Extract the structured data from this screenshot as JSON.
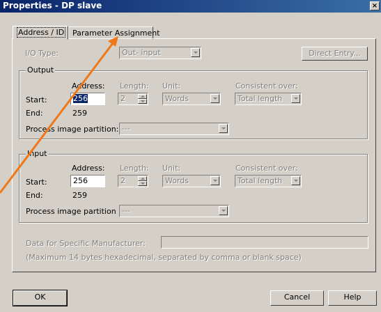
{
  "window": {
    "title": "Properties - DP slave",
    "close": "×"
  },
  "tabs": [
    {
      "label": "Address / ID"
    },
    {
      "label": "Parameter Assignment"
    }
  ],
  "io_type": {
    "label": "I/O Type:",
    "value": "Out- input"
  },
  "direct_entry": "Direct Entry...",
  "output": {
    "title": "Output",
    "headers": {
      "address": "Address:",
      "length": "Length:",
      "unit": "Unit:",
      "consistent": "Consistent over:"
    },
    "start_label": "Start:",
    "end_label": "End:",
    "start_value": "256",
    "end_value": "259",
    "length_value": "2",
    "unit_value": "Words",
    "consistent_value": "Total length",
    "partition_label": "Process image partition:",
    "partition_value": "---"
  },
  "input": {
    "title": "Input",
    "headers": {
      "address": "Address:",
      "length": "Length:",
      "unit": "Unit:",
      "consistent": "Consistent over:"
    },
    "start_label": "Start:",
    "end_label": "End:",
    "start_value": "256",
    "end_value": "259",
    "length_value": "2",
    "unit_value": "Words",
    "consistent_value": "Total length",
    "partition_label": "Process image partition",
    "partition_value": "---"
  },
  "manufacturer": {
    "label": "Data for Specific Manufacturer:",
    "hint": "(Maximum 14 bytes hexadecimal, separated by comma or blank space)",
    "value": ""
  },
  "buttons": {
    "ok": "OK",
    "cancel": "Cancel",
    "help": "Help"
  },
  "annotation": {
    "color": "#f07818"
  }
}
